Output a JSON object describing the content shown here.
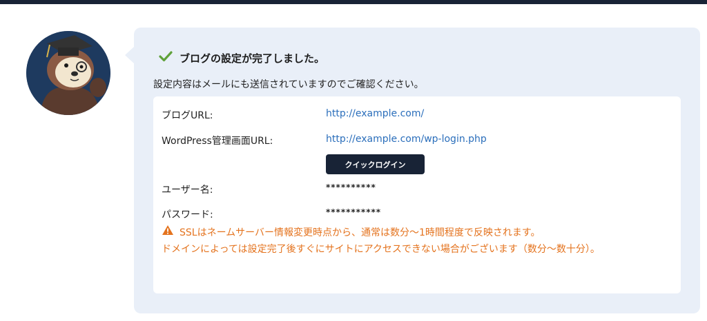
{
  "title": "ブログの設定が完了しました。",
  "subtitle": "設定内容はメールにも送信されていますのでご確認ください。",
  "rows": {
    "blog_url": {
      "label": "ブログURL:",
      "value": "http://example.com/"
    },
    "admin_url": {
      "label": "WordPress管理画面URL:",
      "value": "http://example.com/wp-login.php"
    },
    "username": {
      "label": "ユーザー名:",
      "value": "**********"
    },
    "password": {
      "label": "パスワード:",
      "value": "***********"
    }
  },
  "quick_login_label": "クイックログイン",
  "notice": {
    "line1": "SSLはネームサーバー情報変更時点から、通常は数分〜1時間程度で反映されます。",
    "line2": "ドメインによっては設定完了後すぐにサイトにアクセスできない場合がございます（数分〜数十分）。"
  },
  "icons": {
    "success": "checkmark-icon",
    "warning": "warning-triangle-icon",
    "mascot": "sea-otter-graduate-avatar"
  },
  "colors": {
    "accent": "#182336",
    "link": "#2a6ebb",
    "warning": "#e4731e",
    "success": "#5fa13a",
    "panel": "#e9eff8"
  }
}
